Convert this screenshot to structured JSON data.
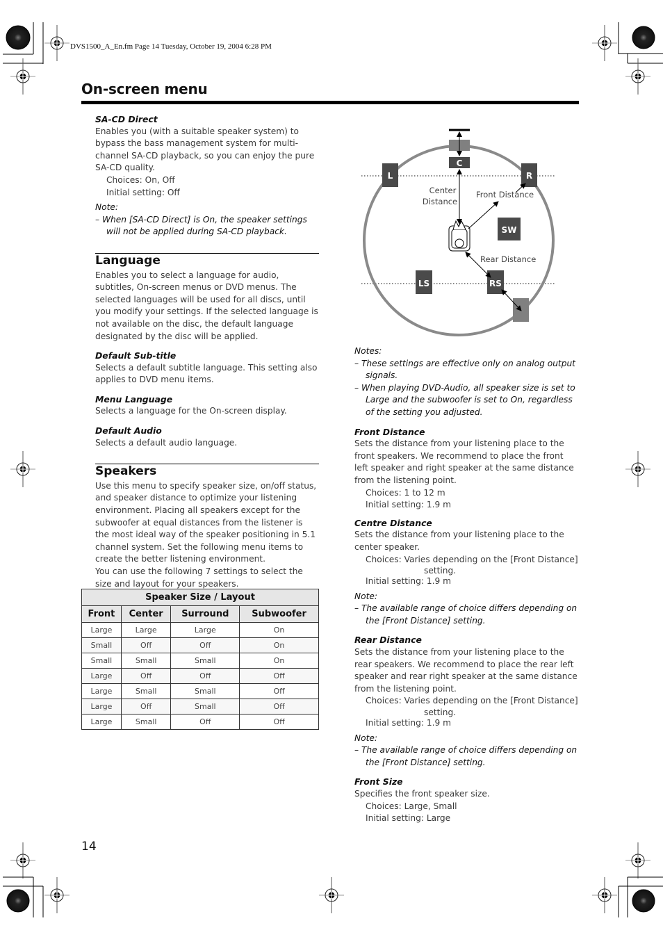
{
  "print_header": "DVS1500_A_En.fm  Page 14  Tuesday, October 19, 2004  6:28 PM",
  "page_title": "On-screen menu",
  "page_number": "14",
  "left": {
    "sacd": {
      "title": "SA-CD Direct",
      "body": "Enables you (with a suitable speaker system) to bypass the bass management system for multi-channel SA-CD playback, so you can enjoy the pure SA-CD quality.",
      "choices": "Choices: On, Off",
      "initial": "Initial setting: Off",
      "note_label": "Note:",
      "note": "–  When [SA-CD Direct] is On, the speaker settings will not be applied during SA-CD playback."
    },
    "language": {
      "heading": "Language",
      "body": "Enables you to select a language for audio, subtitles, On-screen menus or DVD menus. The selected languages will be used for all discs, until you modify your settings. If the selected language is not available on the disc, the default language designated by the disc will be applied.",
      "items": [
        {
          "title": "Default Sub-title",
          "body": "Selects a default subtitle language. This setting also applies to DVD menu items."
        },
        {
          "title": "Menu Language",
          "body": "Selects a language for the On-screen display."
        },
        {
          "title": "Default Audio",
          "body": "Selects a default audio language."
        }
      ]
    },
    "speakers": {
      "heading": "Speakers",
      "body1": "Use this menu to specify speaker size, on/off status, and speaker distance to optimize your listening environment. Placing all speakers except for the subwoofer at equal distances from the listener is the most ideal way of the speaker positioning in 5.1 channel system. Set the following menu items to create the better listening environment.",
      "body2": "You can use the following 7 settings to select the size and layout for your speakers.",
      "table": {
        "title": "Speaker Size / Layout",
        "headers": [
          "Front",
          "Center",
          "Surround",
          "Subwoofer"
        ],
        "rows": [
          [
            "Large",
            "Large",
            "Large",
            "On"
          ],
          [
            "Small",
            "Off",
            "Off",
            "On"
          ],
          [
            "Small",
            "Small",
            "Small",
            "On"
          ],
          [
            "Large",
            "Off",
            "Off",
            "Off"
          ],
          [
            "Large",
            "Small",
            "Small",
            "Off"
          ],
          [
            "Large",
            "Off",
            "Small",
            "Off"
          ],
          [
            "Large",
            "Small",
            "Off",
            "Off"
          ]
        ]
      }
    }
  },
  "diagram": {
    "speakers": {
      "L": "L",
      "C": "C",
      "R": "R",
      "SW": "SW",
      "LS": "LS",
      "RS": "RS"
    },
    "labels": {
      "center_distance_1": "Center",
      "center_distance_2": "Distance",
      "front_distance": "Front Distance",
      "rear_distance": "Rear Distance"
    },
    "colors": {
      "speaker": "#4a4a4a",
      "ideal": "#808080",
      "circle": "#8a8a8a",
      "dots": "#888888"
    }
  },
  "right": {
    "notes_label": "Notes:",
    "notes": [
      "–  These settings are effective only on analog output signals.",
      "–  When playing DVD-Audio, all speaker size is set to Large and the subwoofer is set to On, regardless of the setting you adjusted."
    ],
    "front_distance": {
      "title": "Front Distance",
      "body": "Sets the distance from your listening place to the front speakers. We recommend to place the front left speaker and right speaker at the same distance from the listening point.",
      "choices": "Choices: 1 to 12 m",
      "initial": "Initial setting: 1.9 m"
    },
    "centre_distance": {
      "title": "Centre Distance",
      "body": "Sets the distance from your listening place to the center speaker.",
      "choices_a": "Choices: Varies depending on the [Front Distance]",
      "choices_b": "setting.",
      "initial": "Initial setting: 1.9 m",
      "note_label": "Note:",
      "note": "–  The available range of choice differs depending on the [Front Distance] setting."
    },
    "rear_distance": {
      "title": "Rear Distance",
      "body": "Sets the distance from your listening place to the rear speakers. We recommend to place the rear left speaker and rear right speaker at the same distance from the listening point.",
      "choices_a": "Choices: Varies depending on the [Front Distance]",
      "choices_b": "setting.",
      "initial": "Initial setting: 1.9 m",
      "note_label": "Note:",
      "note": "–  The available range of choice differs depending on the [Front Distance] setting."
    },
    "front_size": {
      "title": "Front Size",
      "body": "Specifies the front speaker size.",
      "choices": "Choices: Large, Small",
      "initial": "Initial setting: Large"
    }
  }
}
